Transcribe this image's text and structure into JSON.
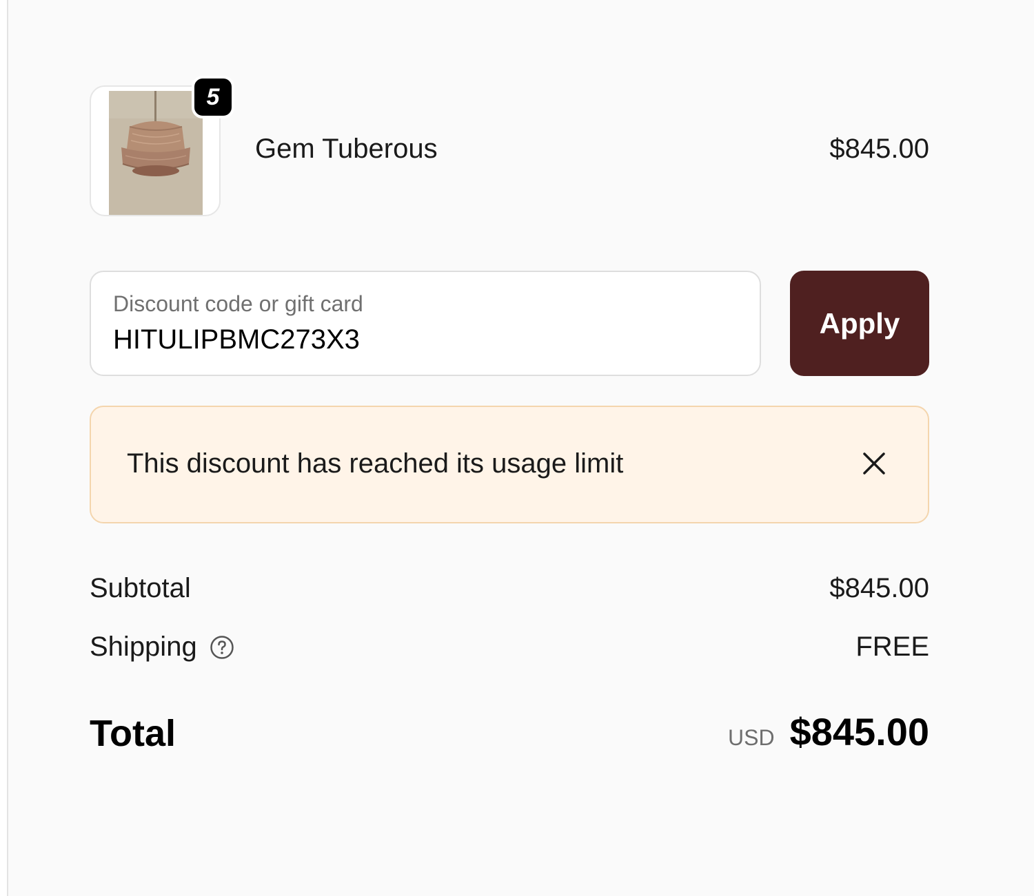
{
  "line_item": {
    "quantity": "5",
    "name": "Gem Tuberous",
    "price": "$845.00"
  },
  "discount": {
    "label": "Discount code or gift card",
    "value": "HITULIPBMC273X3",
    "apply_label": "Apply"
  },
  "warning": {
    "message": "This discount has reached its usage limit"
  },
  "summary": {
    "subtotal_label": "Subtotal",
    "subtotal_value": "$845.00",
    "shipping_label": "Shipping",
    "shipping_value": "FREE",
    "total_label": "Total",
    "currency": "USD",
    "total_value": "$845.00"
  },
  "colors": {
    "apply_button": "#4f2020",
    "warning_background": "#fff4e8",
    "warning_border": "#f4d5ad"
  },
  "icons": {
    "close": "close-icon",
    "shipping_help": "question-circle-icon"
  }
}
